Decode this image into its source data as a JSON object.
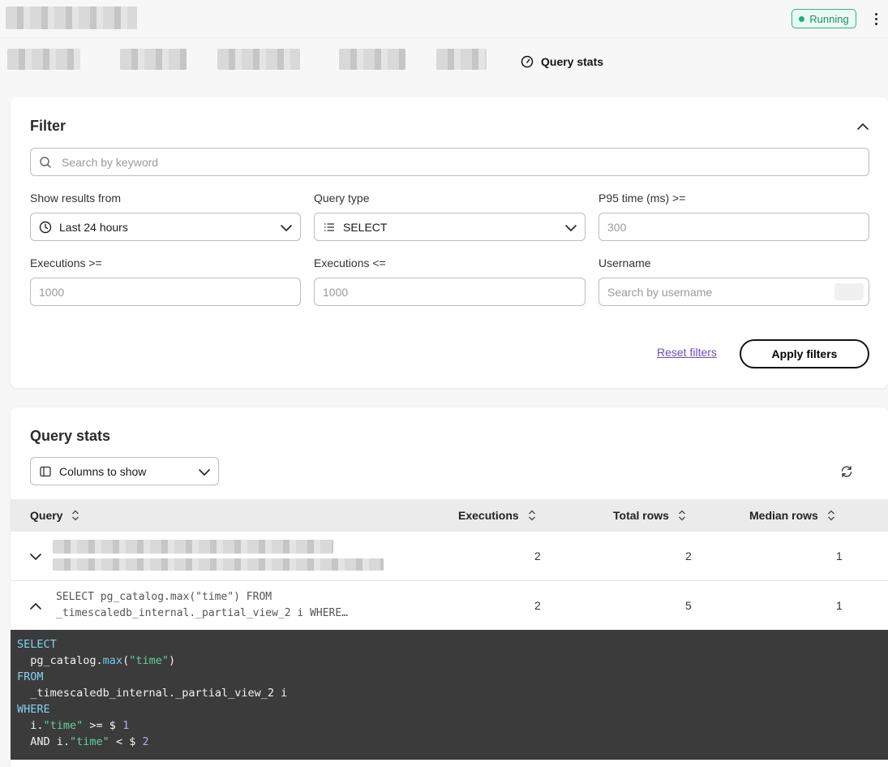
{
  "header": {
    "status_label": "Running",
    "status_color": "#16b37e"
  },
  "nav": {
    "active_tab": "Query stats"
  },
  "filter": {
    "title": "Filter",
    "search_placeholder": "Search by keyword",
    "show_results_label": "Show results from",
    "show_results_value": "Last 24 hours",
    "query_type_label": "Query type",
    "query_type_value": "SELECT",
    "p95_label": "P95 time (ms) >=",
    "p95_placeholder": "300",
    "exec_min_label": "Executions >=",
    "exec_min_placeholder": "1000",
    "exec_max_label": "Executions <=",
    "exec_max_placeholder": "1000",
    "username_label": "Username",
    "username_placeholder": "Search by username",
    "reset_label": "Reset filters",
    "apply_label": "Apply filters"
  },
  "stats": {
    "title": "Query stats",
    "columns_button": "Columns to show",
    "columns": {
      "query": "Query",
      "executions": "Executions",
      "total_rows": "Total rows",
      "median_rows": "Median rows"
    },
    "rows": [
      {
        "query_line1": "",
        "query_line2": "",
        "executions": "2",
        "total_rows": "2",
        "median_rows": "1"
      },
      {
        "query_line1": "SELECT pg_catalog.max(\"time\") FROM",
        "query_line2": "_timescaledb_internal._partial_view_2 i WHERE…",
        "executions": "2",
        "total_rows": "5",
        "median_rows": "1"
      }
    ],
    "code": {
      "select": "SELECT",
      "fn_prefix": "  pg_catalog.",
      "fn_name": "max",
      "fn_open": "(",
      "fn_arg": "\"time\"",
      "fn_close": ")",
      "from": "FROM",
      "table": "  _timescaledb_internal._partial_view_2 i",
      "where": "WHERE",
      "cond1_prefix": "  i.",
      "cond1_col": "\"time\"",
      "cond1_op": " >= $ ",
      "cond1_num": "1",
      "cond2_prefix": "  AND i.",
      "cond2_col": "\"time\"",
      "cond2_op": " < $ ",
      "cond2_num": "2"
    }
  }
}
